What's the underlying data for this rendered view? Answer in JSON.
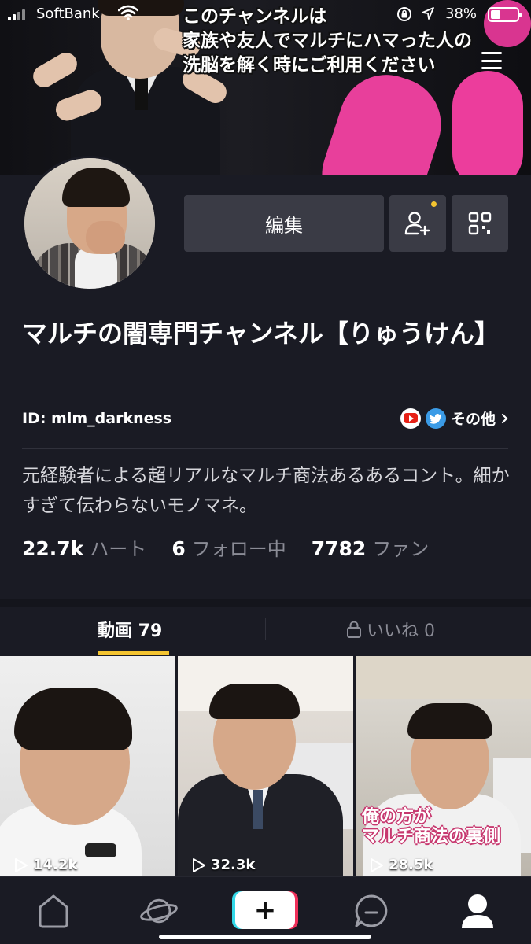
{
  "status_bar": {
    "carrier": "SoftBank",
    "battery_percent": "38%",
    "battery_level": 0.38
  },
  "banner": {
    "text": "このチャンネルは\n家族や友人でマルチにハマった人の\n洗脳を解く時にご利用ください"
  },
  "profile": {
    "edit_label": "編集",
    "name": "マルチの闇専門チャンネル【りゅうけん】",
    "id": "ID: mlm_darkness",
    "social_more": "その他",
    "bio": "元経験者による超リアルなマルチ商法あるあるコント。細かすぎて伝わらないモノマネ。",
    "stats": [
      {
        "value": "22.7k",
        "label": "ハート"
      },
      {
        "value": "6",
        "label": "フォロー中"
      },
      {
        "value": "7782",
        "label": "ファン"
      }
    ]
  },
  "tabs": {
    "videos": "動画 79",
    "likes": "いいね 0"
  },
  "videos": [
    {
      "views": "14.2k",
      "caption": ""
    },
    {
      "views": "32.3k",
      "caption": ""
    },
    {
      "views": "28.5k",
      "caption": "俺の方が\nマルチ商法の裏側"
    }
  ],
  "colors": {
    "background": "#1a1b24",
    "accent": "#f4c430",
    "button": "#3a3b45",
    "muted_text": "#8b8c96"
  },
  "icons": {
    "status": [
      "signal-icon",
      "wifi-icon",
      "orientation-lock-icon",
      "location-icon",
      "battery-icon"
    ],
    "header": [
      "menu-icon",
      "add-friend-icon",
      "qr-code-icon"
    ],
    "social": [
      "youtube-icon",
      "twitter-icon",
      "chevron-right-icon"
    ],
    "tabs": [
      "lock-icon"
    ],
    "videos": [
      "play-icon"
    ],
    "nav": [
      "home-icon",
      "discover-icon",
      "create-icon",
      "inbox-icon",
      "profile-icon"
    ]
  }
}
